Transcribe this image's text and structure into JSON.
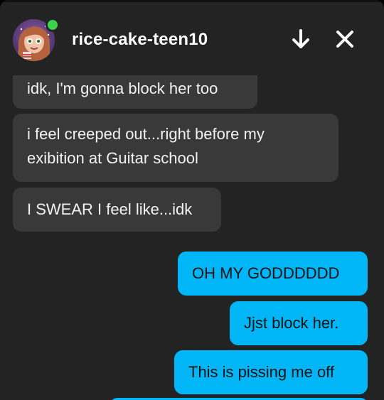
{
  "conversation": {
    "username": "rice-cake-teen10",
    "status": "online"
  },
  "header_actions": {
    "minimize_icon": "arrow-down-icon",
    "close_icon": "close-icon"
  },
  "messages": [
    {
      "sender": "them",
      "lines": [
        "idk, I'm gonna block her too"
      ]
    },
    {
      "sender": "them",
      "lines": [
        "i feel creeped out...right before my",
        "exibition at Guitar school"
      ]
    },
    {
      "sender": "them",
      "lines": [
        "I SWEAR I feel like...idk"
      ]
    },
    {
      "sender": "me",
      "lines": [
        "OH MY GODDDDDD"
      ]
    },
    {
      "sender": "me",
      "lines": [
        "Jjst block her."
      ]
    },
    {
      "sender": "me",
      "lines": [
        "This is pissing me off"
      ]
    }
  ],
  "colors": {
    "panel_bg": "#232323",
    "incoming_bubble": "#393939",
    "outgoing_bubble": "#00b6f7",
    "online_dot": "#3bd24d"
  }
}
